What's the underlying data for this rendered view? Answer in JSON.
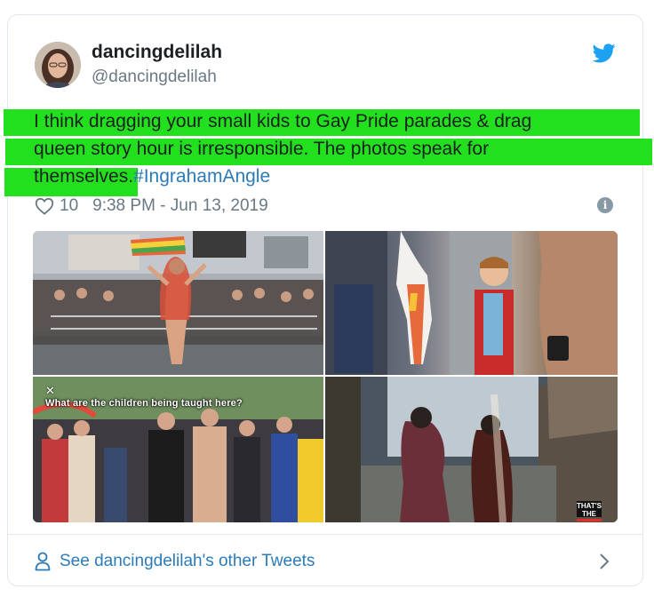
{
  "tweet": {
    "display_name": "dancingdelilah",
    "handle": "@dancingdelilah",
    "text_lines": [
      "I think dragging your small kids to Gay Pride parades & drag",
      "queen story hour is irresponsible. The photos speak for",
      "themselves."
    ],
    "hashtag": "#IngrahamAngle",
    "like_count": "10",
    "timestamp": "9:38 PM - Jun 13, 2019",
    "highlight_color": "#22e01e"
  },
  "media": {
    "overlay_caption": "What are the children being taught here?",
    "overlay_close": "✕",
    "watermark_lines": [
      "THAT'S",
      "THE"
    ]
  },
  "footer": {
    "link_text": "See dancingdelilah's other Tweets"
  },
  "colors": {
    "twitter_blue": "#1da1f2",
    "link_blue": "#2b7bb9",
    "muted_gray": "#697882"
  },
  "icons": {
    "brand": "twitter-bird-icon",
    "like": "heart-icon",
    "info": "info-icon",
    "profile": "person-icon",
    "next": "chevron-right-icon"
  }
}
